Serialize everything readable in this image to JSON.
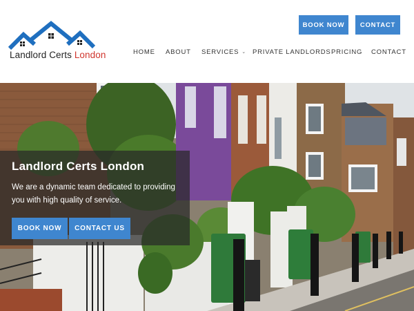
{
  "brand": {
    "name_part1": "Landlord Certs ",
    "name_part2": "London",
    "colors": {
      "blue": "#1f6fbf",
      "red": "#d0342c",
      "button": "#3f86cf"
    }
  },
  "header": {
    "book_now": "BOOK NOW",
    "contact": "CONTACT"
  },
  "nav": {
    "items": [
      {
        "label": "HOME"
      },
      {
        "label": "ABOUT"
      },
      {
        "label": "SERVICES",
        "icon": "chevron-down-icon"
      },
      {
        "label": "PRIVATE LANDLORDS"
      },
      {
        "label": "PRICING"
      },
      {
        "label": "CONTACT"
      }
    ]
  },
  "hero": {
    "title": "Landlord Certs London",
    "text": "We are a dynamic team dedicated to providing you with high quality of service.",
    "book_now": "BOOK NOW",
    "contact_us": "CONTACT US"
  }
}
